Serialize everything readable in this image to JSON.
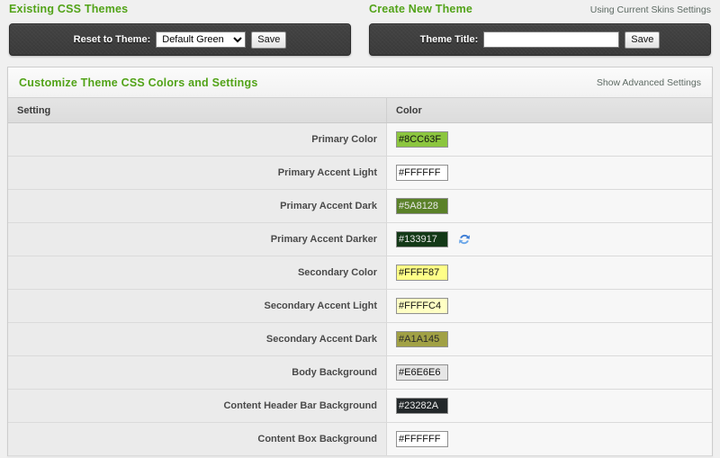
{
  "existing_themes": {
    "title": "Existing CSS Themes",
    "reset_label": "Reset to Theme:",
    "selected_theme": "Default Green",
    "theme_options": [
      "Default Green"
    ],
    "save_label": "Save"
  },
  "create_theme": {
    "title": "Create New Theme",
    "note": "Using Current Skins Settings",
    "theme_title_label": "Theme Title:",
    "theme_title_value": "",
    "theme_title_placeholder": "",
    "save_label": "Save"
  },
  "customize": {
    "title": "Customize Theme CSS Colors and Settings",
    "advanced_link": "Show Advanced Settings",
    "columns": {
      "setting": "Setting",
      "color": "Color"
    },
    "rows": [
      {
        "label": "Primary Color",
        "value": "#8CC63F",
        "swatch": "#8CC63F",
        "text_color": "#111111",
        "has_refresh": false
      },
      {
        "label": "Primary Accent Light",
        "value": "#FFFFFF",
        "swatch": "#FFFFFF",
        "text_color": "#111111",
        "has_refresh": false
      },
      {
        "label": "Primary Accent Dark",
        "value": "#5A8128",
        "swatch": "#5A8128",
        "text_color": "#e8e8e8",
        "has_refresh": false
      },
      {
        "label": "Primary Accent Darker",
        "value": "#133917",
        "swatch": "#133917",
        "text_color": "#e8e8e8",
        "has_refresh": true
      },
      {
        "label": "Secondary Color",
        "value": "#FFFF87",
        "swatch": "#FFFF87",
        "text_color": "#111111",
        "has_refresh": false
      },
      {
        "label": "Secondary Accent Light",
        "value": "#FFFFC4",
        "swatch": "#FFFFC4",
        "text_color": "#111111",
        "has_refresh": false
      },
      {
        "label": "Secondary Accent Dark",
        "value": "#A1A145",
        "swatch": "#A1A145",
        "text_color": "#2b2b2b",
        "has_refresh": false
      },
      {
        "label": "Body Background",
        "value": "#E6E6E6",
        "swatch": "#E6E6E6",
        "text_color": "#111111",
        "has_refresh": false
      },
      {
        "label": "Content Header Bar Background",
        "value": "#23282A",
        "swatch": "#23282A",
        "text_color": "#eeeeee",
        "has_refresh": false
      },
      {
        "label": "Content Box Background",
        "value": "#FFFFFF",
        "swatch": "#FFFFFF",
        "text_color": "#111111",
        "has_refresh": false
      }
    ]
  },
  "icons": {
    "refresh": "refresh-icon"
  },
  "colors": {
    "heading_green": "#52a318",
    "panel_dark": "#3b3b3b"
  }
}
